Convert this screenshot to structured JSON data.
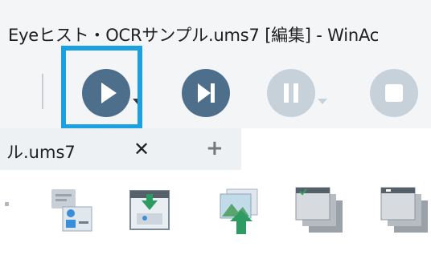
{
  "window": {
    "title": "Eyeヒスト・OCRサンプル.ums7 [編集] - WinAc"
  },
  "toolbar": {
    "buttons": [
      {
        "name": "run",
        "icon": "play-icon",
        "enabled": true,
        "has_dropdown": true,
        "highlighted": true
      },
      {
        "name": "step",
        "icon": "step-forward-icon",
        "enabled": true,
        "has_dropdown": false
      },
      {
        "name": "pause",
        "icon": "pause-icon",
        "enabled": false,
        "has_dropdown": true
      },
      {
        "name": "stop",
        "icon": "stop-icon",
        "enabled": false,
        "has_dropdown": false
      }
    ],
    "colors": {
      "active": "#4d6f8c",
      "disabled": "#c7d1da",
      "highlight": "#1ba0e2"
    }
  },
  "tabs": {
    "active_label": "ル.ums7",
    "close_glyph": "✕",
    "add_glyph": "+"
  },
  "ribbon": {
    "icons": [
      "image-match-icon",
      "screen-capture-icon",
      "image-upload-icon",
      "window-stack-icon",
      "window-list-icon"
    ]
  }
}
